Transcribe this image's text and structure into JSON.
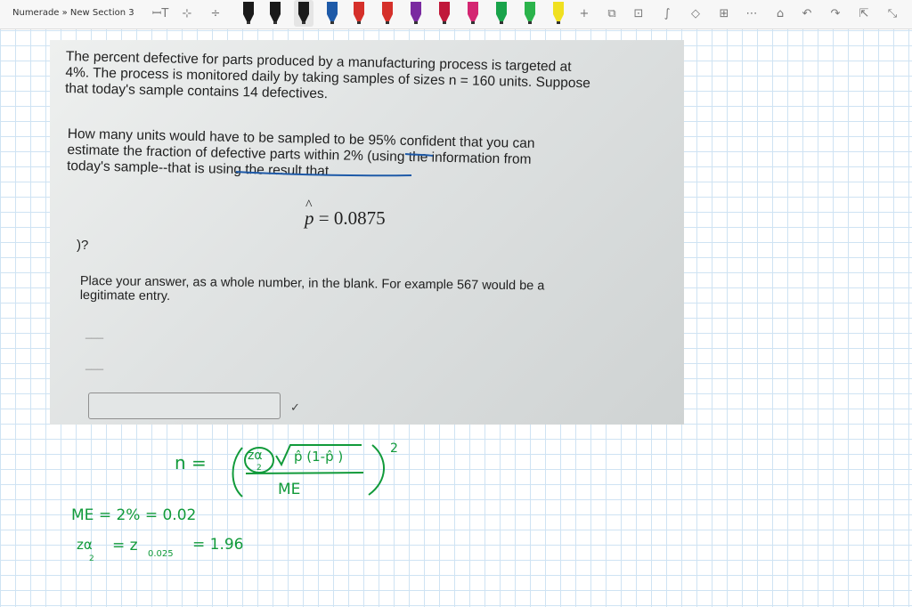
{
  "breadcrumb": "Numerade » New Section 3",
  "toolbar": {
    "pen_colors": [
      "#1a1a1a",
      "#1a1a1a",
      "#1a1a1a",
      "#1e5aa8",
      "#d5302a",
      "#d5302a",
      "#7a2aa0",
      "#c0183a",
      "#d42672",
      "#19a34a",
      "#2bb34b",
      "#f0e020",
      "#27c3c8",
      "#3a8a4a"
    ],
    "icons": [
      "text-direction-icon",
      "lasso-add-icon",
      "insert-space-icon",
      "add-pen-icon",
      "ink-to-shape-icon",
      "convert-icon",
      "ink-math-icon",
      "eraser-icon",
      "table-icon",
      "more-icon",
      "tell-me-icon",
      "undo-icon",
      "redo-icon",
      "share-icon",
      "fullscreen-icon"
    ]
  },
  "question": {
    "para1": [
      "The percent defective for parts produced by a manufacturing process is targeted at",
      "4%. The process is monitored daily by taking samples of sizes n = 160 units. Suppose",
      "that today's sample contains 14 defectives."
    ],
    "para2": [
      "How many units would have to be sampled to be 95% confident that you can",
      "estimate the fraction of defective parts within 2% (using the information from",
      "today's sample--that is using the result that"
    ],
    "phat_symbol": "p",
    "phat_rest": " = 0.0875",
    "qmark": ")?",
    "para3": [
      "Place your answer, as a whole number, in the blank. For example 567 would be a",
      "legitimate entry."
    ],
    "dashes": [
      "___",
      "___"
    ],
    "check_glyph": "✓"
  },
  "handwriting": {
    "formula_lhs": "n =",
    "formula_z": "zα",
    "formula_z_sub": "2",
    "formula_sqrt": "p̂ (1-p̂ )",
    "formula_den": "ME",
    "formula_exp": "2",
    "me_line": "ME = 2% = 0.02",
    "z_lhs": "zα",
    "z_lhs_sub": "2",
    "z_mid": "= z",
    "z_mid_sub": "0.025",
    "z_rhs": "= 1.96"
  }
}
